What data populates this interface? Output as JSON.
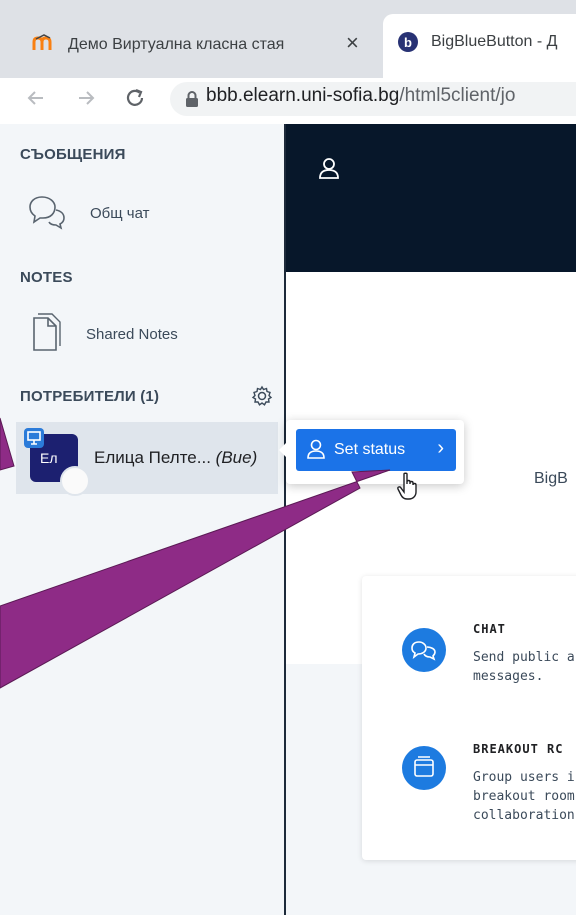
{
  "browser": {
    "tabs": [
      {
        "title": "Демо Виртуална класна стая",
        "close": "×"
      },
      {
        "title": "BigBlueButton - Д"
      }
    ],
    "url": {
      "host": "bbb.elearn.uni-sofia.bg",
      "path": "/html5client/jo"
    }
  },
  "sidebar": {
    "messages_title": "СЪОБЩЕНИЯ",
    "public_chat_label": "Общ чат",
    "notes_title": "NOTES",
    "shared_notes_label": "Shared Notes",
    "users_title": "ПОТРЕБИТЕЛИ (1)",
    "user": {
      "initials": "Ел",
      "name": "Елица Пелте...",
      "you_label": "(Вие)"
    }
  },
  "dropdown": {
    "set_status_label": "Set status",
    "chevron": "›"
  },
  "main": {
    "partial_text": "BigB",
    "features": [
      {
        "title": "CHAT",
        "desc": "Send public ar\nmessages."
      },
      {
        "title": "BREAKOUT RC",
        "desc": "Group users ir\nbreakout room\ncollaboration."
      }
    ]
  },
  "colors": {
    "annotation_arrow": "#8e2b86",
    "accent": "#1b73e8",
    "dark_header": "#07172a"
  }
}
